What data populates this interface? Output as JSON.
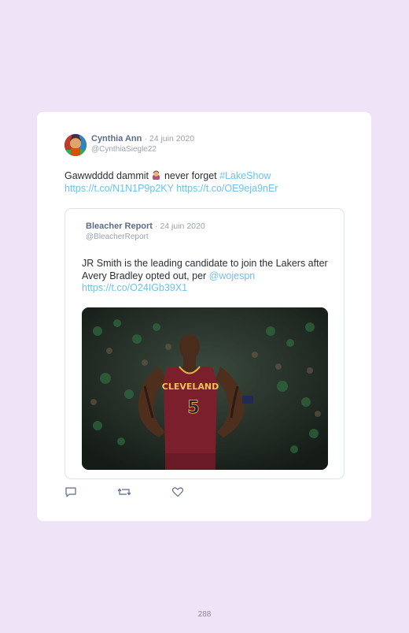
{
  "tweet": {
    "author_name": "Cynthia Ann",
    "date": "· 24 juin 2020",
    "handle": "@CynthiaSiegle22",
    "text_before_emoji": "Gawwdddd dammit ",
    "text_after_emoji": " never forget ",
    "hashtag": "#LakeShow",
    "link1": "https://t.co/N1N1P9p2KY",
    "link2": "https://t.co/OE9eja9nEr",
    "emoji": "woman-facepalming-emoji"
  },
  "quoted_tweet": {
    "author_name": "Bleacher Report",
    "date": "· 24 juin 2020",
    "handle": "@BleacherReport",
    "text": "JR Smith is the leading candidate to join the Lakers after Avery Bradley opted out, per ",
    "mention": "@wojespn",
    "link": "https://t.co/O24IGb39X1",
    "photo": {
      "jersey_text": "CLEVELAND",
      "jersey_number": "5"
    }
  },
  "actions": {
    "reply_icon": "reply-icon",
    "retweet_icon": "retweet-icon",
    "like_icon": "heart-icon"
  },
  "colors": {
    "background": "#eee3f7",
    "card": "#ffffff",
    "link": "#6fc0ea",
    "name": "#5b6b8b",
    "muted": "#9aa3ad"
  },
  "footer": {
    "page_number": "288"
  }
}
